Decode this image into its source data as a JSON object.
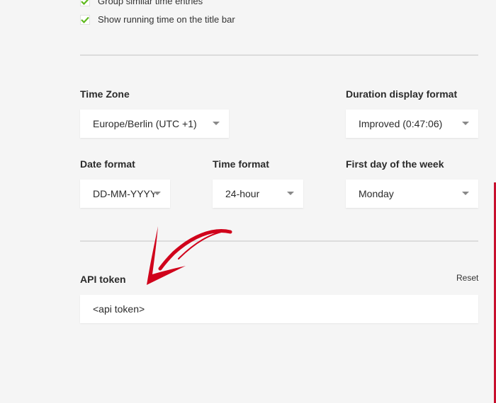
{
  "checkboxes": [
    {
      "label": "Group similar time entries",
      "checked": true
    },
    {
      "label": "Show running time on the title bar",
      "checked": true
    }
  ],
  "fields": {
    "time_zone": {
      "label": "Time Zone",
      "value": "Europe/Berlin (UTC +1)"
    },
    "duration_format": {
      "label": "Duration display format",
      "value": "Improved (0:47:06)"
    },
    "date_format": {
      "label": "Date format",
      "value": "DD-MM-YYYY"
    },
    "time_format": {
      "label": "Time format",
      "value": "24-hour"
    },
    "first_day": {
      "label": "First day of the week",
      "value": "Monday"
    }
  },
  "api_token": {
    "label": "API token",
    "reset_label": "Reset",
    "value": "<api token>"
  },
  "colors": {
    "check": "#5fb91f",
    "annotation_arrow": "#d0021b",
    "background": "#f5f5f5"
  }
}
